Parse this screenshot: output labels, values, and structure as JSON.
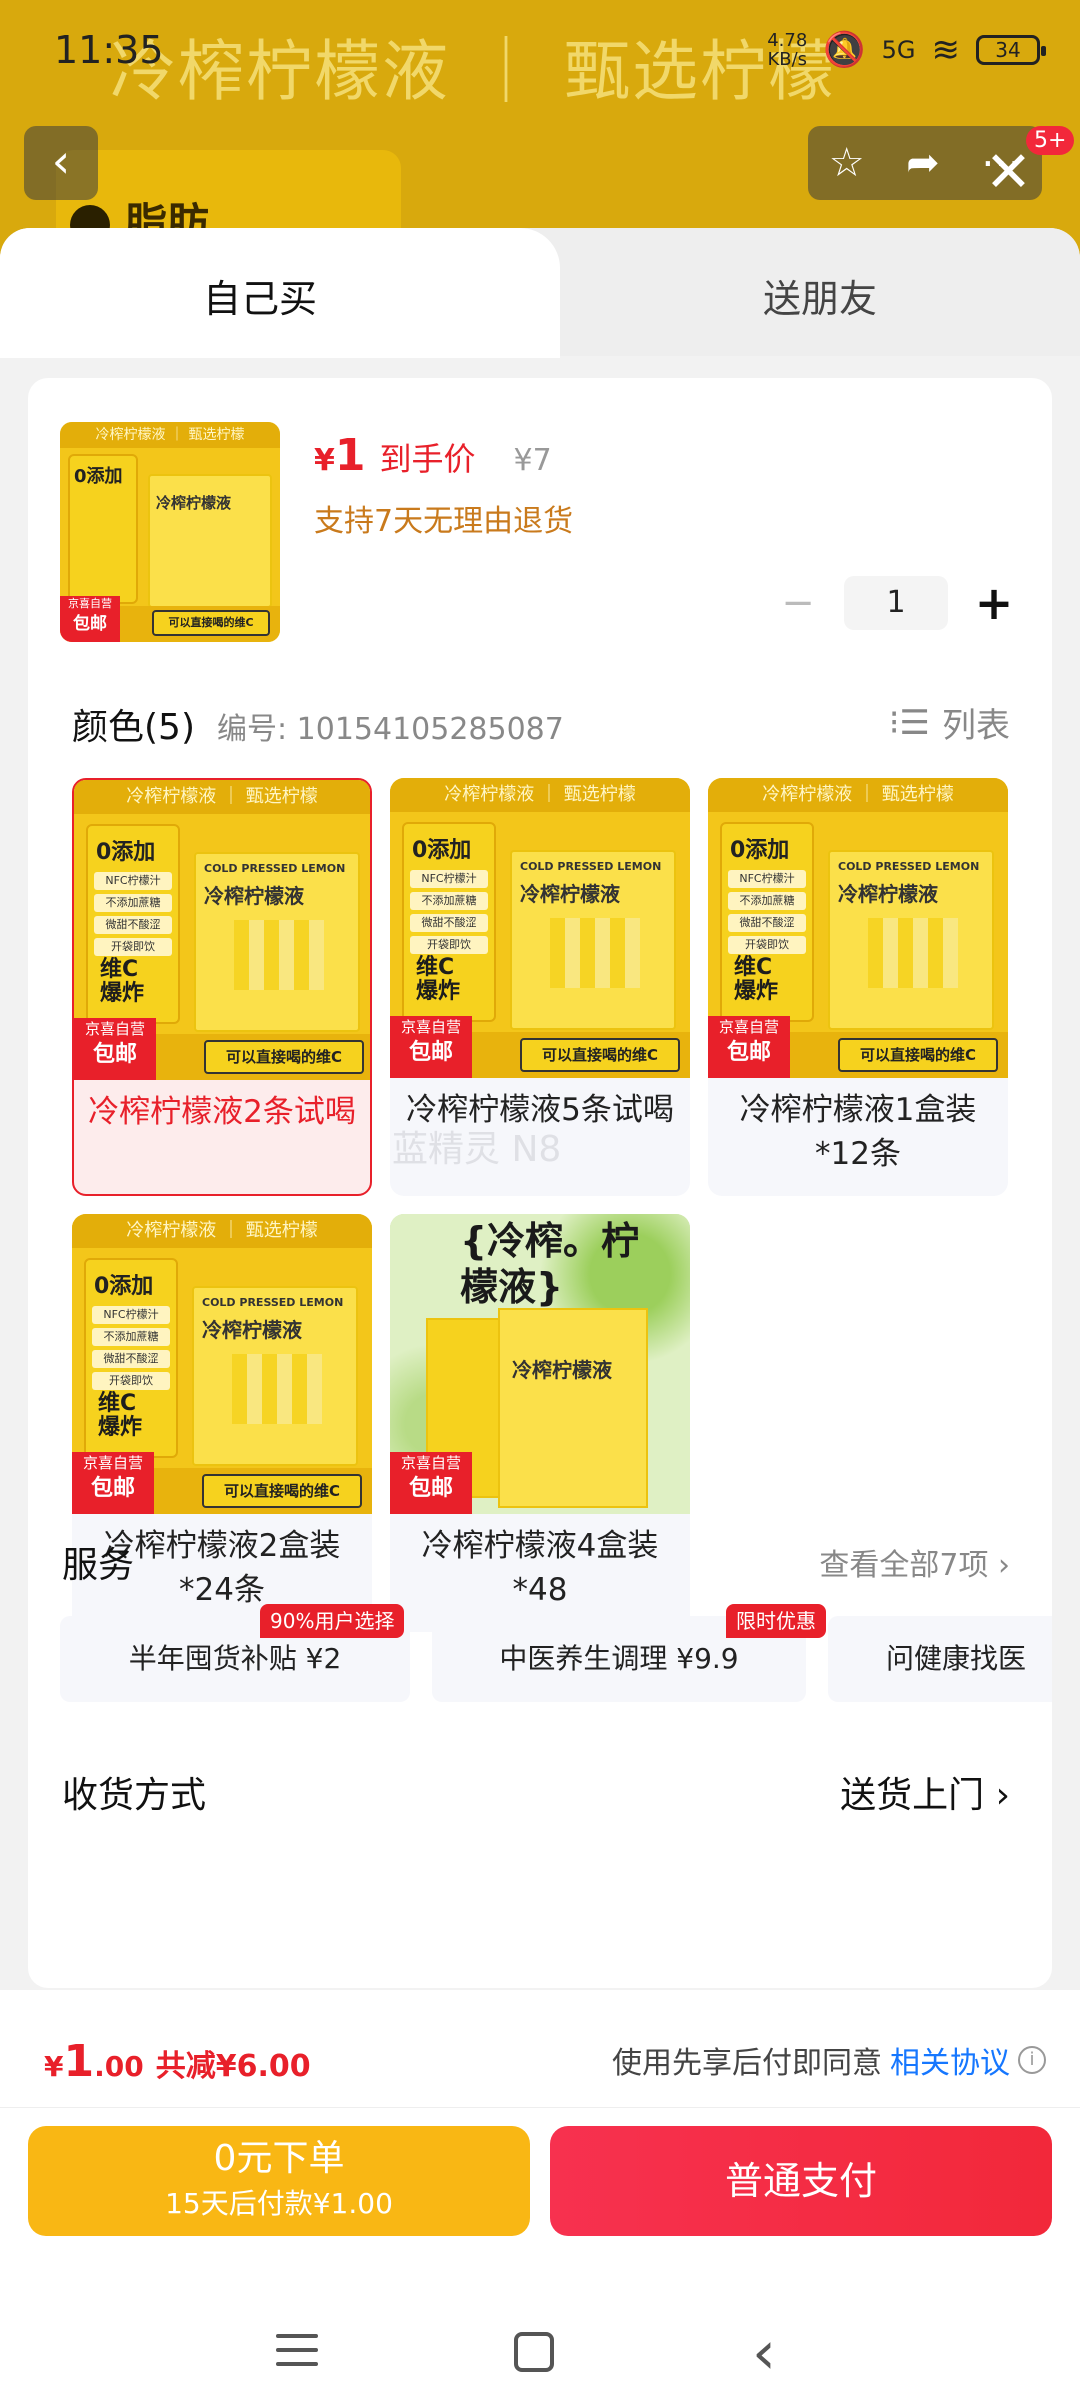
{
  "status_bar": {
    "time": "11:35",
    "net_speed": "4.78",
    "net_unit": "KB/s",
    "signal": "5G",
    "battery": "34"
  },
  "background": {
    "banner": "冷榨柠檬液 ｜ 甄选柠檬",
    "fat_label": "脂肪",
    "notification_count": "5+"
  },
  "tabs": {
    "buy_self": "自己买",
    "gift_friend": "送朋友"
  },
  "product": {
    "currency": "¥",
    "price": "1",
    "price_label": "到手价",
    "original_price": "¥7",
    "return_policy": "支持7天无理由退货",
    "quantity": "1"
  },
  "colors": {
    "title": "颜色(5)",
    "code": "编号: 10154105285087",
    "view_mode": "列表",
    "image_text": {
      "topband": "冷榨柠檬液 ｜ 甄选柠檬",
      "zero_add": "0添加",
      "pills": [
        "NFC柠檬汁",
        "不添加蔗糖",
        "微甜不酸涩",
        "开袋即饮"
      ],
      "vitc": "维C爆炸",
      "box_en": "COLD PRESSED LEMON",
      "box_name": "冷榨柠檬液",
      "cta": "可以直接喝的维C",
      "jd_small": "京喜自营",
      "jd_big": "包邮",
      "green_title": "{冷榨。柠檬液}"
    },
    "variants": [
      {
        "label": "冷榨柠檬液2条试喝",
        "selected": true
      },
      {
        "label": "冷榨柠檬液5条试喝",
        "selected": false
      },
      {
        "label": "冷榨柠檬液1盒装*12条",
        "selected": false
      },
      {
        "label": "冷榨柠檬液2盒装*24条",
        "selected": false
      },
      {
        "label": "冷榨柠檬液4盒装*48",
        "selected": false
      }
    ]
  },
  "service": {
    "title": "服务",
    "view_all": "查看全部7项 ›",
    "items": [
      {
        "label": "半年囤货补贴  ¥2",
        "badge": "90%用户选择"
      },
      {
        "label": "中医养生调理  ¥9.9",
        "badge": "限时优惠"
      },
      {
        "label": "问健康找医",
        "badge": ""
      }
    ]
  },
  "shipping": {
    "title": "收货方式",
    "value": "送货上门  ›"
  },
  "footer": {
    "total_currency": "¥",
    "total_int": "1",
    "total_dec": ".00",
    "savings": "共减¥6.00",
    "agree_text": "使用先享后付即同意",
    "agree_link": "相关协议",
    "zero_order_title": "0元下单",
    "zero_order_sub": "15天后付款¥1.00",
    "pay_button": "普通支付"
  },
  "watermark": "蓝精灵 N8",
  "colors_theme": {
    "accent_red": "#e8202a",
    "accent_yellow": "#f9b714",
    "link_blue": "#1677ff"
  }
}
